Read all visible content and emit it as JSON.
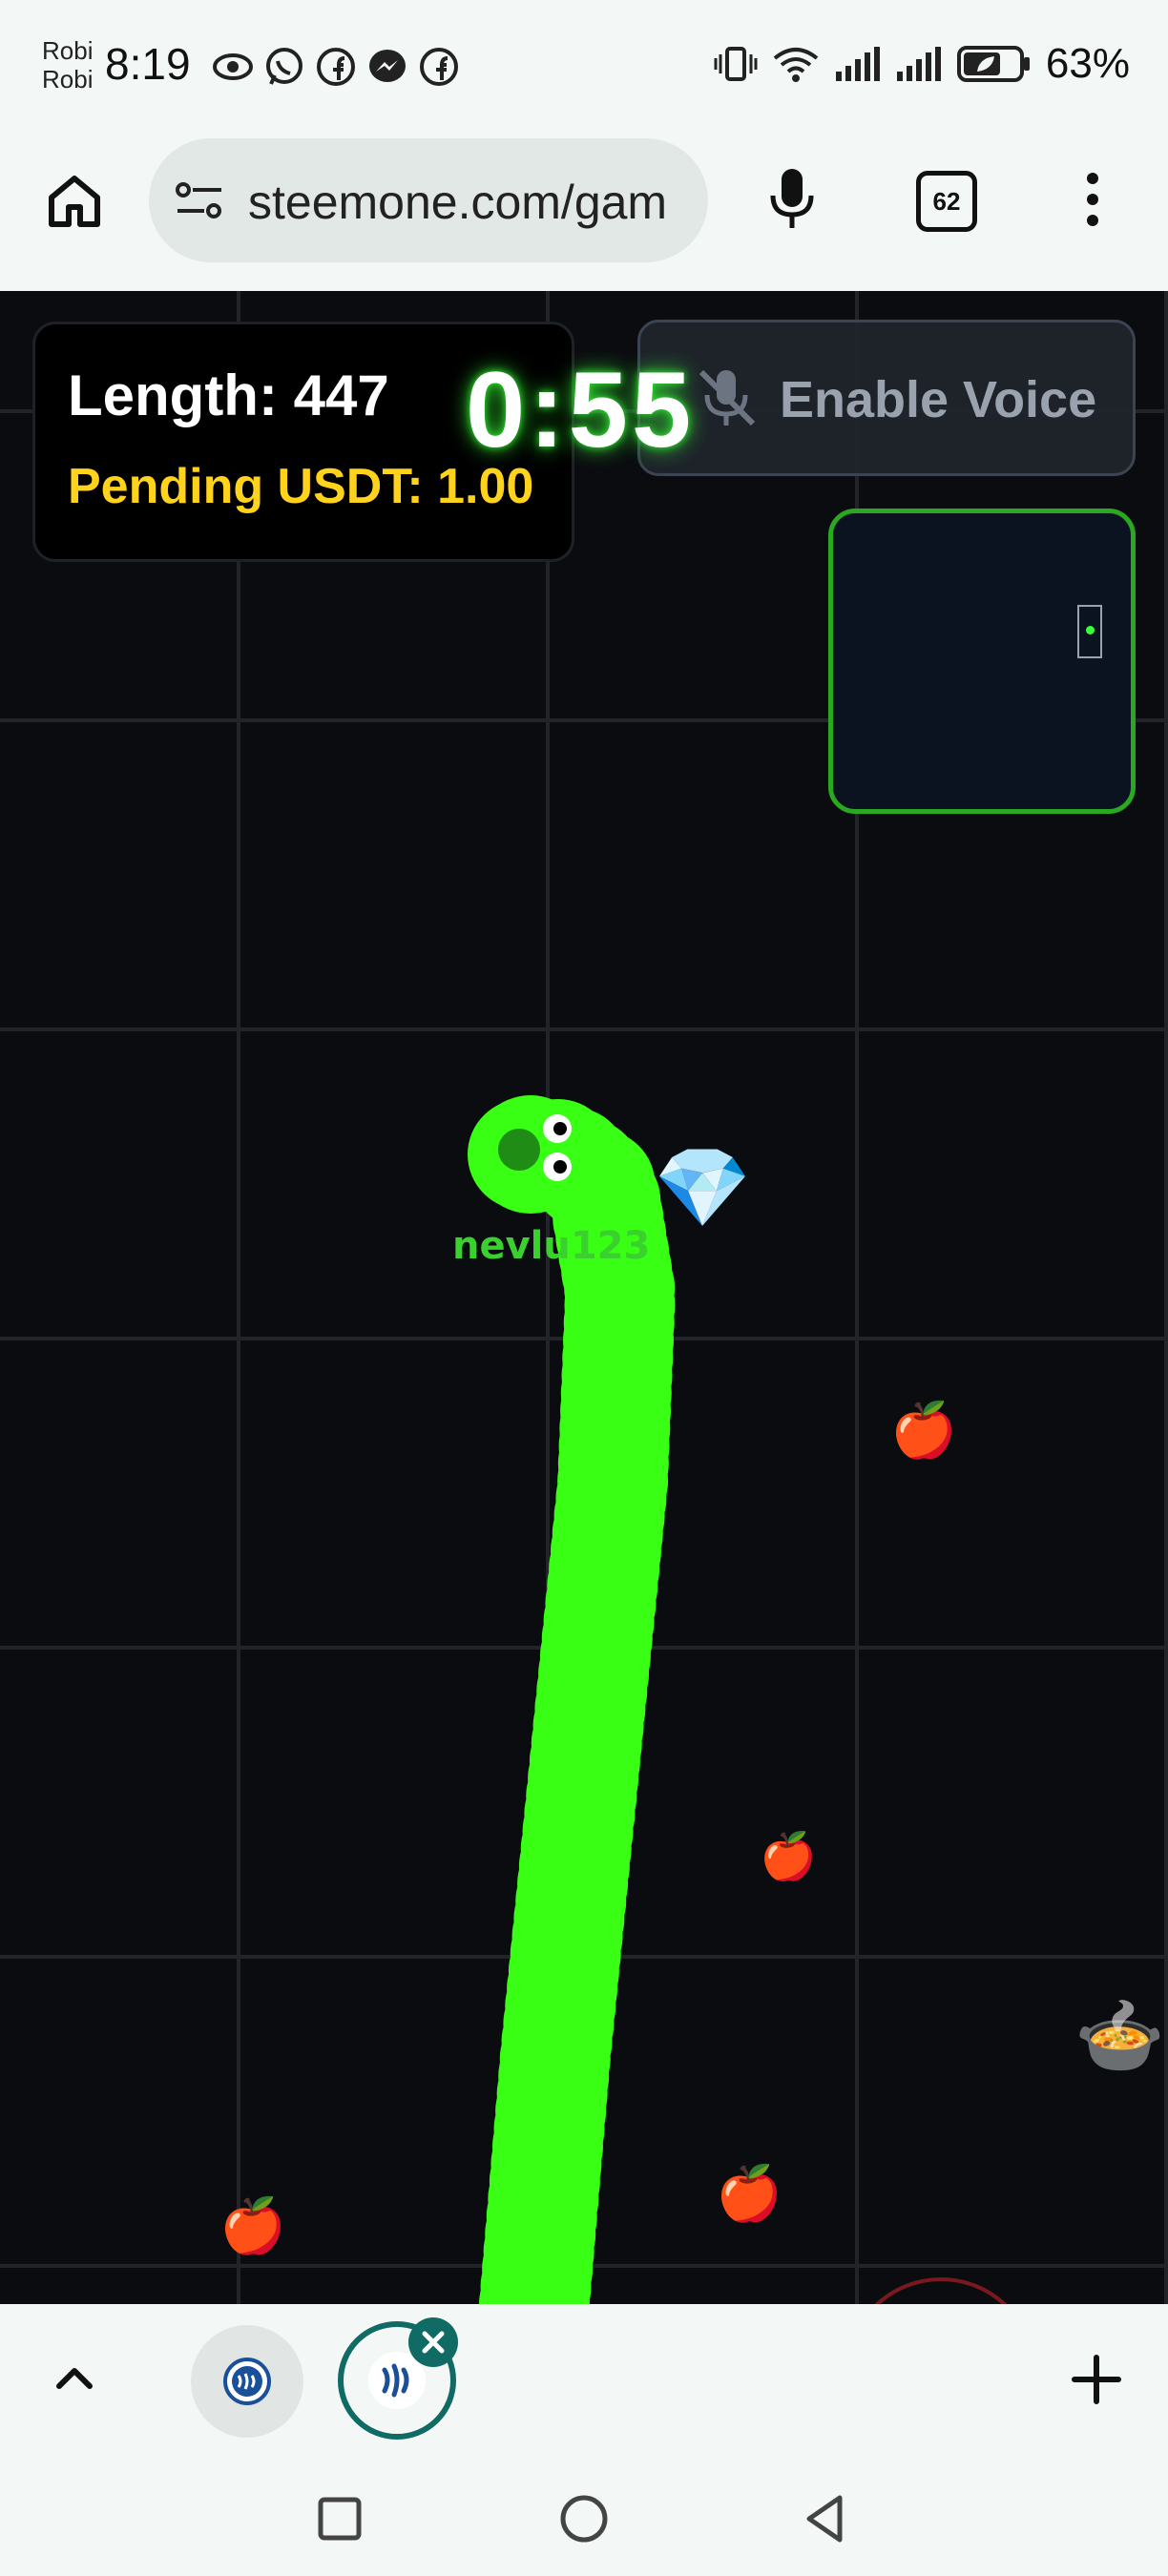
{
  "status_bar": {
    "carrier_line1": "Robi",
    "carrier_line2": "Robi",
    "time": "8:19",
    "battery": "63%",
    "notification_icons": [
      "eye-icon",
      "whatsapp-icon",
      "facebook-icon",
      "messenger-icon",
      "facebook-icon"
    ],
    "system_icons": [
      "vibrate-icon",
      "wifi-icon",
      "signal-icon",
      "signal-icon",
      "battery-saver-icon"
    ]
  },
  "browser": {
    "url": "steemone.com/gam",
    "tab_count": "62"
  },
  "game": {
    "length_text": "Length: 447",
    "pending_text": "Pending USDT: 1.00",
    "timer": "0:55",
    "voice_label": "Enable Voice",
    "player_name": "nevlu123",
    "colors": {
      "snake": "#39ff14",
      "timer_glow": "#2fe52f",
      "pending": "#ffd21c",
      "minimap_border": "#2aa820"
    },
    "food": [
      {
        "name": "diamond",
        "glyph": "💎"
      },
      {
        "name": "apple",
        "glyph": "🍎"
      },
      {
        "name": "apple",
        "glyph": "🍎"
      },
      {
        "name": "apple",
        "glyph": "🍎"
      },
      {
        "name": "apple",
        "glyph": "🍎"
      },
      {
        "name": "pot-of-food",
        "glyph": "🍲"
      }
    ]
  },
  "tab_strip": {
    "groups": [
      "steemit-tab-icon",
      "steemit-tab-icon"
    ]
  }
}
